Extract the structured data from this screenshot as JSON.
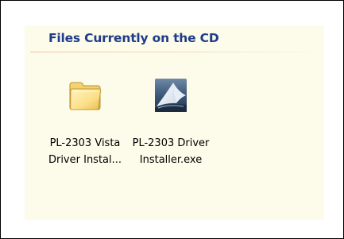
{
  "group": {
    "title": "Files Currently on the CD"
  },
  "files": [
    {
      "icon": "folder-icon",
      "label_line1": "PL-2303 Vista",
      "label_line2": "Driver Instal..."
    },
    {
      "icon": "installer-exe-icon",
      "label_line1": "PL-2303 Driver",
      "label_line2": "Installer.exe"
    }
  ],
  "colors": {
    "panel_background": "#fdfbea",
    "group_title": "#1f3c88",
    "group_rule": "#e9c9a3"
  }
}
